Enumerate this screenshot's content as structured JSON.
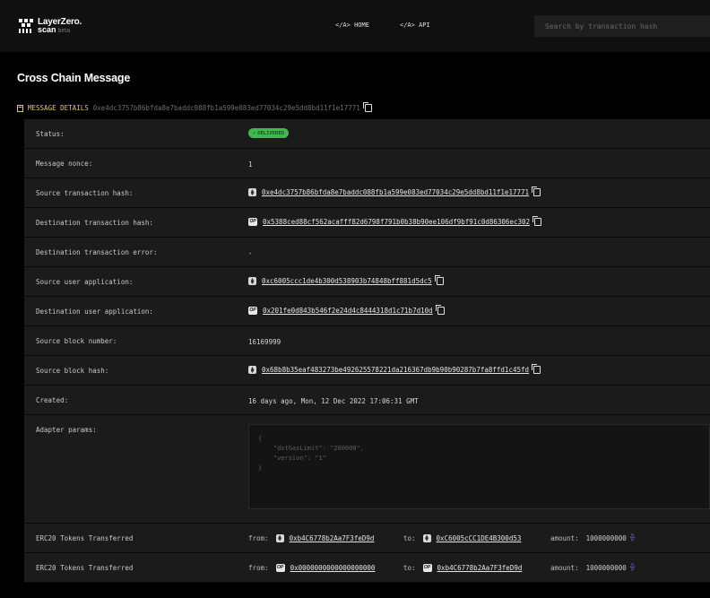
{
  "header": {
    "logo_name": "LayerZero.",
    "logo_sub": "scan",
    "logo_badge": "beta",
    "nav": [
      "</A> HOME",
      "</A> API"
    ],
    "search_placeholder": "Search by transaction hash"
  },
  "page_title": "Cross Chain Message",
  "section": {
    "label": "MESSAGE DETAILS",
    "hash": "0xe4dc3757b86bfda8e7baddc088fb1a599e083ed77034c29e5dd8bd11f1e17771"
  },
  "rows": {
    "status": {
      "label": "Status:",
      "value": "DELIVERED"
    },
    "nonce": {
      "label": "Message nonce:",
      "value": "1"
    },
    "src_tx": {
      "label": "Source transaction hash:",
      "chain": "eth",
      "value": "0xe4dc3757b86bfda8e7baddc088fb1a599e083ed77034c29e5dd8bd11f1e17771"
    },
    "dst_tx": {
      "label": "Destination transaction hash:",
      "chain": "op",
      "value": "0x5388ced88cf562acafff82d6798f791b0b38b90ee106df9bf91c0d86306ec302"
    },
    "dst_err": {
      "label": "Destination transaction error:",
      "value": "-"
    },
    "src_app": {
      "label": "Source user application:",
      "chain": "eth",
      "value": "0xc6005ccc1de4b300d538903b74848bff881d5dc5"
    },
    "dst_app": {
      "label": "Destination user application:",
      "chain": "op",
      "value": "0x201fe0d843b546f2e24d4c8444318d1c71b7d10d"
    },
    "block_num": {
      "label": "Source block number:",
      "value": "16169999"
    },
    "block_hash": {
      "label": "Source block hash:",
      "chain": "eth",
      "value": "0x68b8b35eaf483273be492625578221da216367db9b90b90287b7fa8ffd1c45fd"
    },
    "created": {
      "label": "Created:",
      "value": "16 days ago, Mon, 12 Dec 2022 17:06:31 GMT"
    },
    "adapter": {
      "label": "Adapter params:",
      "value": "{\n    \"dstGasLimit\": \"200000\",\n    \"version\": \"1\"\n}"
    }
  },
  "erc20": [
    {
      "label": "ERC20 Tokens Transferred",
      "from_label": "from:",
      "from_chain": "eth",
      "from": "0xb4C6778b2Aa7F3feD9d",
      "to_label": "to:",
      "to_chain": "eth",
      "to": "0xC6005cCC1DE4B300d53",
      "amount_label": "amount:",
      "amount": "1000000000"
    },
    {
      "label": "ERC20 Tokens Transferred",
      "from_label": "from:",
      "from_chain": "op",
      "from": "0x0000000000000000000",
      "to_label": "to:",
      "to_chain": "op",
      "to": "0xb4C6778b2Aa7F3feD9d",
      "amount_label": "amount:",
      "amount": "1000000000"
    }
  ],
  "chain_badges": {
    "op": "OP"
  },
  "colors": {
    "accent": "#e8c46a",
    "status_green": "#3dba4e",
    "row_bg": "#1b1b1b",
    "token_icon": "#7b6cff"
  }
}
